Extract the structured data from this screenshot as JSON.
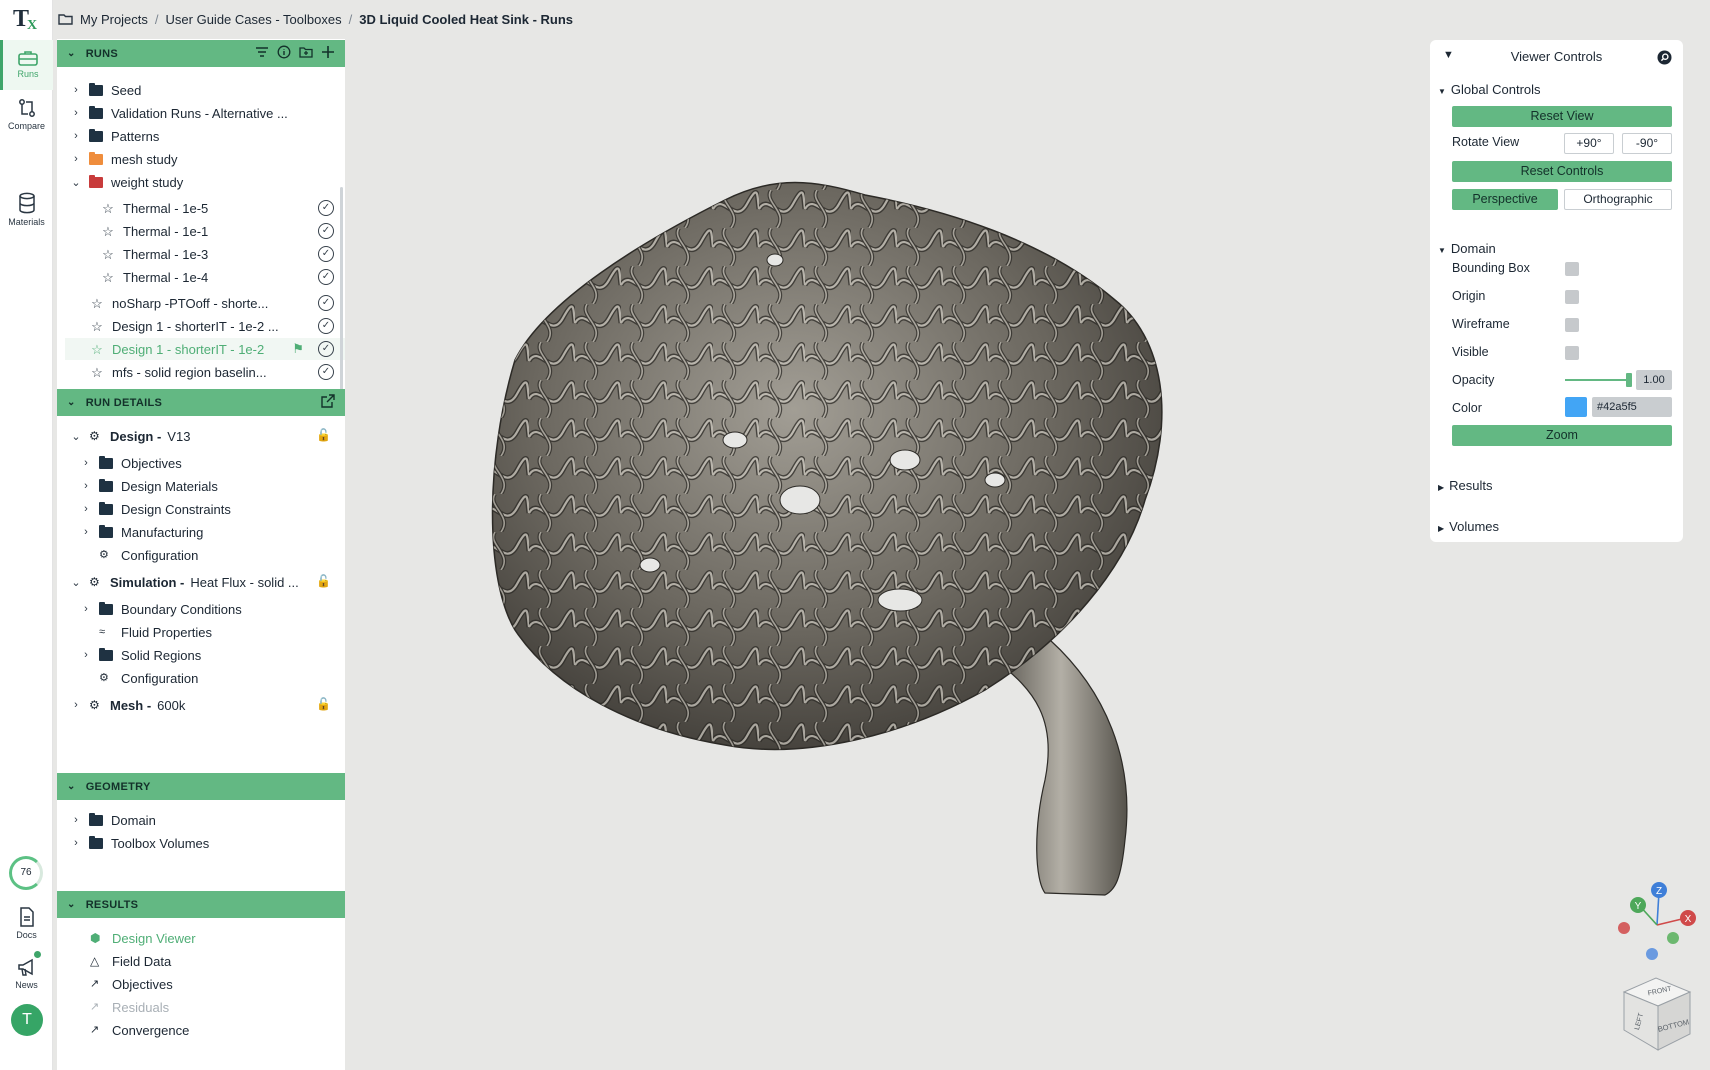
{
  "app": {
    "logo_text": "T",
    "logo_sub": "X"
  },
  "rail": {
    "runs": "Runs",
    "compare": "Compare",
    "materials": "Materials",
    "progress": "76",
    "docs": "Docs",
    "news": "News",
    "avatar": "T"
  },
  "breadcrumb": {
    "items": [
      "My Projects",
      "User Guide Cases - Toolboxes",
      "3D Liquid Cooled Heat Sink - Runs"
    ]
  },
  "runs": {
    "header": "RUNS",
    "items": [
      {
        "label": "Seed"
      },
      {
        "label": "Validation Runs - Alternative ..."
      },
      {
        "label": "Patterns"
      },
      {
        "label": "mesh study"
      },
      {
        "label": "weight study"
      },
      {
        "label": "Thermal - 1e-5"
      },
      {
        "label": "Thermal - 1e-1"
      },
      {
        "label": "Thermal - 1e-3"
      },
      {
        "label": "Thermal - 1e-4"
      },
      {
        "label": "noSharp -PTOoff - shorte..."
      },
      {
        "label": "Design 1 - shorterIT - 1e-2 ..."
      },
      {
        "label": "Design 1 - shorterIT - 1e-2"
      },
      {
        "label": "mfs - solid region baselin..."
      }
    ]
  },
  "run_details": {
    "header": "RUN DETAILS",
    "design_title": "Design -",
    "design_version": "V13",
    "design_children": [
      "Objectives",
      "Design Materials",
      "Design Constraints",
      "Manufacturing",
      "Configuration"
    ],
    "sim_title": "Simulation -",
    "sim_value": "Heat Flux - solid ...",
    "sim_children": [
      "Boundary Conditions",
      "Fluid Properties",
      "Solid Regions",
      "Configuration"
    ],
    "mesh_title": "Mesh -",
    "mesh_value": "600k"
  },
  "geometry": {
    "header": "GEOMETRY",
    "items": [
      "Domain",
      "Toolbox Volumes"
    ]
  },
  "results": {
    "header": "RESULTS",
    "items": [
      "Design Viewer",
      "Field Data",
      "Objectives",
      "Residuals",
      "Convergence"
    ]
  },
  "viewer_controls": {
    "title": "Viewer Controls",
    "global": "Global Controls",
    "reset_view": "Reset View",
    "rotate_view": "Rotate View",
    "rot_plus": "+90°",
    "rot_minus": "-90°",
    "reset_controls": "Reset Controls",
    "perspective": "Perspective",
    "orthographic": "Orthographic",
    "domain": "Domain",
    "bounding_box": "Bounding Box",
    "origin": "Origin",
    "wireframe": "Wireframe",
    "visible": "Visible",
    "opacity": "Opacity",
    "opacity_value": "1.00",
    "color": "Color",
    "color_value": "#42a5f5",
    "zoom": "Zoom",
    "results": "Results",
    "volumes": "Volumes"
  },
  "gizmo": {
    "x": "X",
    "y": "Y",
    "z": "Z",
    "front": "FRONT",
    "left": "LEFT",
    "bottom": "BOTTOM"
  },
  "colors": {
    "accent": "#63b883",
    "model": "#6e6a62",
    "background": "#e7e7e5"
  }
}
